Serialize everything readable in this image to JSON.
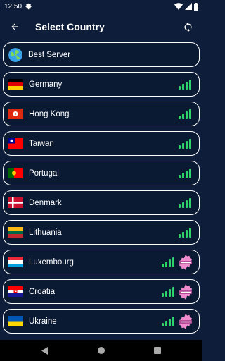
{
  "status": {
    "time": "12:50"
  },
  "header": {
    "title": "Select Country"
  },
  "countries": [
    {
      "name": "Best Server",
      "flag": "globe-icon",
      "premium": false
    },
    {
      "name": "Germany",
      "flag": "germany-flag-icon",
      "premium": false
    },
    {
      "name": "Hong Kong",
      "flag": "hong-kong-flag-icon",
      "premium": false
    },
    {
      "name": "Taiwan",
      "flag": "taiwan-flag-icon",
      "premium": false
    },
    {
      "name": "Portugal",
      "flag": "portugal-flag-icon",
      "premium": false
    },
    {
      "name": "Denmark",
      "flag": "denmark-flag-icon",
      "premium": false
    },
    {
      "name": "Lithuania",
      "flag": "lithuania-flag-icon",
      "premium": false
    },
    {
      "name": "Luxembourg",
      "flag": "luxembourg-flag-icon",
      "premium": true
    },
    {
      "name": "Croatia",
      "flag": "croatia-flag-icon",
      "premium": true
    },
    {
      "name": "Ukraine",
      "flag": "ukraine-flag-icon",
      "premium": true
    }
  ],
  "colors": {
    "background": "#0e1e3a",
    "row": "#0b1a33",
    "signal": "#2fd36b",
    "premium": "#f18bd0"
  }
}
